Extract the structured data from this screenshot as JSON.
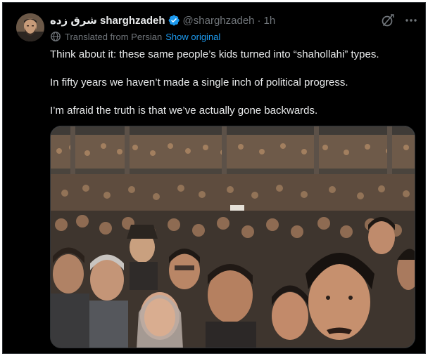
{
  "tweet": {
    "display_name": "شرق زده sharghzadeh",
    "handle": "@sharghzadeh",
    "separator": "·",
    "timestamp": "1h",
    "verified": true,
    "translation_label": "Translated from Persian",
    "show_original_label": "Show original",
    "paragraphs": [
      "Think about it: these same people’s kids turned into “shahollahi” types.",
      "In fifty years we haven’t made a single inch of political progress.",
      "I’m afraid the truth is that we’ve actually gone backwards."
    ]
  },
  "icons": {
    "avatar": "profile-avatar",
    "verified": "verified-badge-icon",
    "grok": "grok-icon",
    "more": "more-options-icon",
    "translate": "translate-globe-icon"
  },
  "colors": {
    "background": "#000000",
    "primary_text": "#e7e9ea",
    "secondary_text": "#71767b",
    "link": "#1d9bf0",
    "verified_badge": "#1d9bf0",
    "border": "#2f3336"
  }
}
